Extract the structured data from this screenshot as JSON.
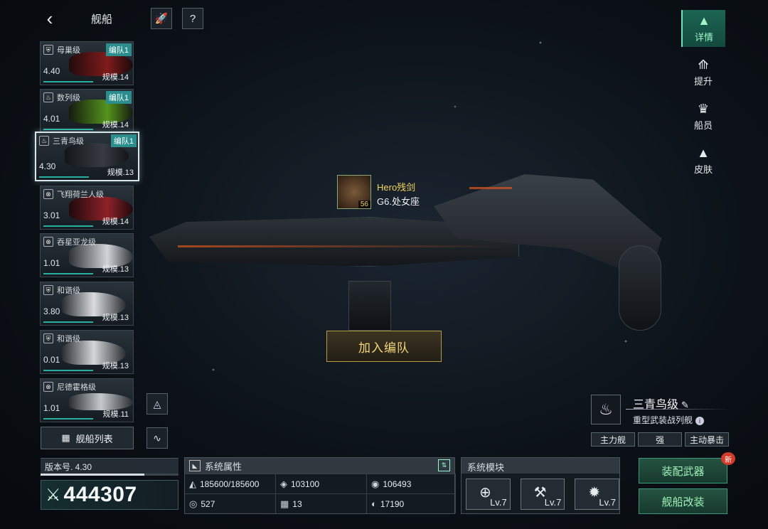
{
  "header": {
    "title": "舰船"
  },
  "ship_list": [
    {
      "name": "母巢级",
      "fleet": "编队1",
      "version": "4.40",
      "scale": "规模.14",
      "art_color": "#5a1010"
    },
    {
      "name": "数列级",
      "fleet": "编队1",
      "version": "4.01",
      "scale": "规模.14",
      "art_color": "#3e5a12"
    },
    {
      "name": "三青鸟级",
      "fleet": "编队1",
      "version": "4.30",
      "scale": "规模.13",
      "art_color": "#34383e"
    },
    {
      "name": "飞翔荷兰人级",
      "fleet": "",
      "version": "3.01",
      "scale": "规模.14",
      "art_color": "#7a1c22"
    },
    {
      "name": "吞星亚龙级",
      "fleet": "",
      "version": "1.01",
      "scale": "规模.13",
      "art_color": "#c8ccd2"
    },
    {
      "name": "和谐级",
      "fleet": "",
      "version": "3.80",
      "scale": "规模.13",
      "art_color": "#d0d4d8"
    },
    {
      "name": "和谐级",
      "fleet": "",
      "version": "0.01",
      "scale": "规模.13",
      "art_color": "#c4c8ce"
    },
    {
      "name": "尼德霍格级",
      "fleet": "",
      "version": "1.01",
      "scale": "规模.11",
      "art_color": "#b8bcc2"
    }
  ],
  "ship_list_button": "舰船列表",
  "version": {
    "label": "版本号. 4.30",
    "progress": 0.75
  },
  "power": "444307",
  "captain": {
    "name": "Hero残剑",
    "rank": "G6.处女座",
    "level": "56"
  },
  "join_button": "加入编队",
  "right_nav": [
    {
      "label": "详情",
      "icon": "▲"
    },
    {
      "label": "提升",
      "icon": "⟰"
    },
    {
      "label": "船员",
      "icon": "♛"
    },
    {
      "label": "皮肤",
      "icon": "▲"
    }
  ],
  "ship_info": {
    "name": "三青鸟级",
    "type": "重型武装战列舰",
    "tags": [
      "主力舰",
      "强",
      "主动暴击"
    ]
  },
  "attributes": {
    "title": "系统属性",
    "items": [
      {
        "icon": "◭",
        "value": "185600/185600"
      },
      {
        "icon": "◈",
        "value": "103100"
      },
      {
        "icon": "◉",
        "value": "106493"
      },
      {
        "icon": "◎",
        "value": "527"
      },
      {
        "icon": "▦",
        "value": "13"
      },
      {
        "icon": "◐",
        "value": "17190"
      }
    ]
  },
  "modules": {
    "title": "系统模块",
    "items": [
      {
        "icon": "⊕",
        "level": "Lv.7"
      },
      {
        "icon": "⚒",
        "level": "Lv.7"
      },
      {
        "icon": "✹",
        "level": "Lv.7"
      }
    ]
  },
  "actions": {
    "weapons": "装配武器",
    "modify": "舰船改装",
    "new_badge": "新"
  },
  "colors": {
    "accent": "#2b8d8e",
    "gold": "#f4d57a",
    "green": "#9ff0b8"
  }
}
